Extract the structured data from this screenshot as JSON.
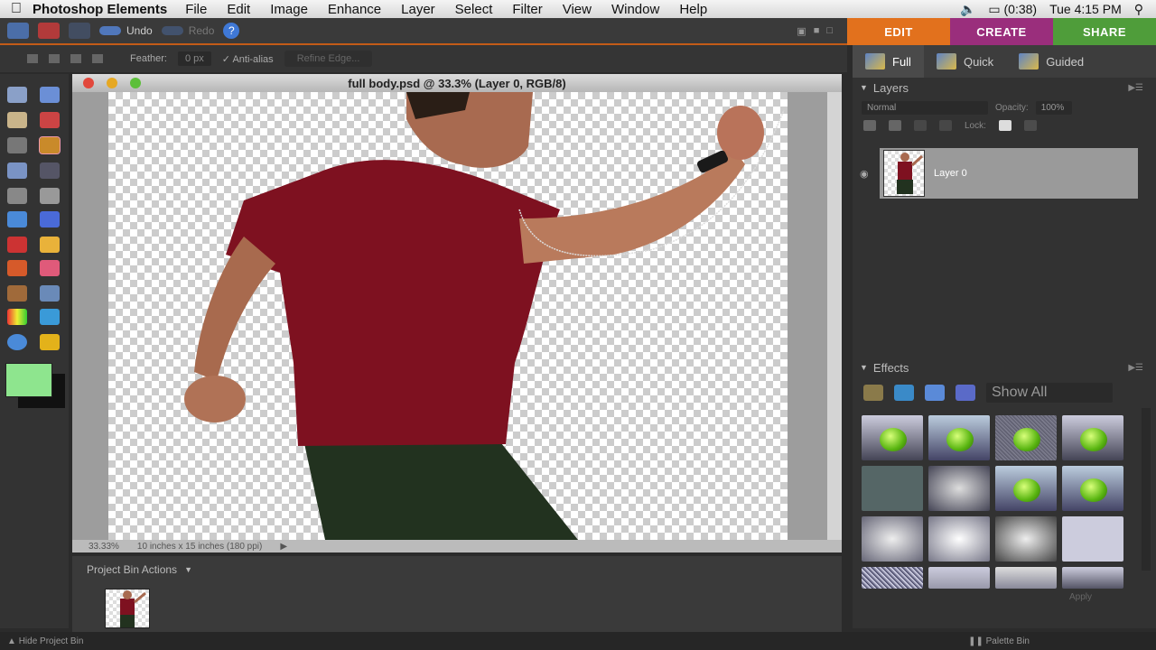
{
  "menubar": {
    "app_name": "Photoshop Elements",
    "items": [
      "File",
      "Edit",
      "Image",
      "Enhance",
      "Layer",
      "Select",
      "Filter",
      "View",
      "Window",
      "Help"
    ],
    "battery": "(0:38)",
    "clock": "Tue 4:15 PM"
  },
  "topbar": {
    "undo": "Undo",
    "redo": "Redo",
    "help": "?"
  },
  "mode_tabs": [
    "EDIT",
    "CREATE",
    "SHARE"
  ],
  "sub_tabs": [
    "Full",
    "Quick",
    "Guided"
  ],
  "options": {
    "feather_label": "Feather:",
    "feather_value": "0 px",
    "antialias": "Anti-alias",
    "refine": "Refine Edge..."
  },
  "document": {
    "title": "full body.psd @ 33.3% (Layer 0, RGB/8)",
    "zoom": "33.33%",
    "doc_size": "10 inches x 15 inches (180 ppi)"
  },
  "project_bin": {
    "title": "Project Bin Actions"
  },
  "layers": {
    "title": "Layers",
    "blend_mode": "Normal",
    "opacity_label": "Opacity:",
    "opacity_value": "100%",
    "lock_label": "Lock:",
    "layer_name": "Layer 0"
  },
  "effects": {
    "title": "Effects",
    "filter": "Show All",
    "apply": "Apply"
  },
  "bottom": {
    "hide_bin": "Hide Project Bin",
    "palette_bin": "Palette Bin"
  },
  "colors": {
    "foreground": "#8ee58e",
    "background": "#111111",
    "edit_tab": "#e2711d",
    "create_tab": "#9a2e7c",
    "share_tab": "#4f9d3a"
  }
}
